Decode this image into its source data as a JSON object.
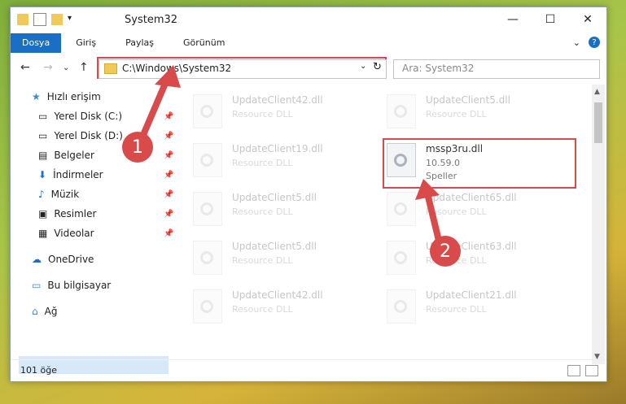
{
  "window": {
    "title": "System32"
  },
  "ribbon": {
    "tabs": [
      "Dosya",
      "Giriş",
      "Paylaş",
      "Görünüm"
    ]
  },
  "address": {
    "path": "C:\\Windows\\System32"
  },
  "search": {
    "placeholder": "Ara: System32"
  },
  "sidebar": {
    "items": [
      {
        "label": "Hızlı erişim"
      },
      {
        "label": "Yerel Disk (C:)"
      },
      {
        "label": "Yerel Disk (D:)"
      },
      {
        "label": "Belgeler"
      },
      {
        "label": "İndirmeler"
      },
      {
        "label": "Müzik"
      },
      {
        "label": "Resimler"
      },
      {
        "label": "Videolar"
      },
      {
        "label": "OneDrive"
      },
      {
        "label": "Bu bilgisayar"
      },
      {
        "label": "Ağ"
      }
    ]
  },
  "files": [
    {
      "name": "UpdateClient42.dll",
      "desc": "Resource DLL"
    },
    {
      "name": "UpdateClient5.dll",
      "desc": "Resource DLL"
    },
    {
      "name": "UpdateClient19.dll",
      "desc": "Resource DLL"
    },
    {
      "name": "mssp3ru.dll",
      "version": "10.59.0",
      "desc": "Speller"
    },
    {
      "name": "UpdateClient5.dll",
      "desc": "Resource DLL"
    },
    {
      "name": "UpdateClient65.dll",
      "desc": "Resource DLL"
    },
    {
      "name": "UpdateClient5.dll",
      "desc": "Resource DLL"
    },
    {
      "name": "UpdateClient63.dll",
      "desc": "Resource DLL"
    },
    {
      "name": "UpdateClient42.dll",
      "desc": "Resource DLL"
    },
    {
      "name": "UpdateClient21.dll",
      "desc": "Resource DLL"
    }
  ],
  "status": {
    "count": "101 öğe"
  },
  "annotations": {
    "badge1": "1",
    "badge2": "2"
  }
}
